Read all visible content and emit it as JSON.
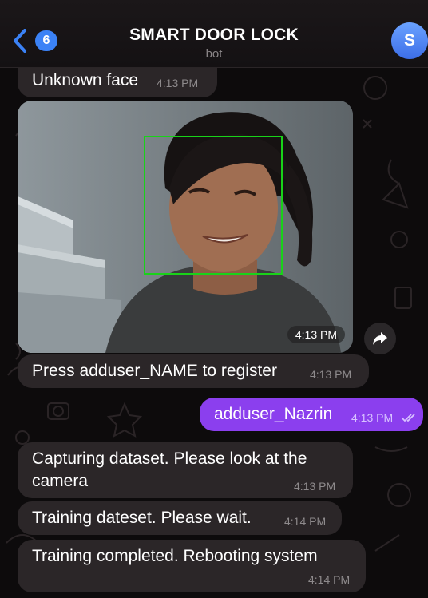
{
  "header": {
    "back_badge": "6",
    "title": "SMART DOOR LOCK",
    "subtitle": "bot",
    "avatar_letter": "S"
  },
  "messages": [
    {
      "dir": "in",
      "text": "Unknown face",
      "time": "4:13 PM"
    },
    {
      "dir": "in",
      "type": "photo",
      "time": "4:13 PM"
    },
    {
      "dir": "in",
      "text": "Press adduser_NAME to register",
      "time": "4:13 PM"
    },
    {
      "dir": "out",
      "text": "adduser_Nazrin",
      "time": "4:13 PM",
      "status": "read"
    },
    {
      "dir": "in",
      "text_lines": [
        "Capturing dataset. Please look at the",
        "camera"
      ],
      "time": "4:13 PM"
    },
    {
      "dir": "in",
      "text": "Training dateset. Please wait.",
      "time": "4:14 PM"
    },
    {
      "dir": "in",
      "text": "Training completed. Rebooting system",
      "time": "4:14 PM"
    }
  ],
  "icons": {
    "back": "chevron-left-icon",
    "share": "share-forward-icon",
    "read_receipt": "double-check-icon"
  },
  "colors": {
    "background": "#0d0b0c",
    "incoming_bubble": "#2b2628",
    "outgoing_bubble": "#8b3fee",
    "badge": "#3b82f6",
    "face_box": "#19d219"
  }
}
